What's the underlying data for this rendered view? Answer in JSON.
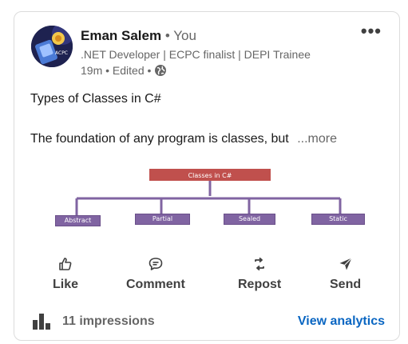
{
  "author": {
    "name": "Eman Salem",
    "relation": "• You",
    "headline": ".NET Developer | ECPC finalist | DEPI Trainee",
    "meta": "19m • Edited •",
    "avatar_text": "ACPC"
  },
  "post": {
    "title": "Types of Classes in C#",
    "body": "The foundation of any program is classes, but",
    "more_label": "...more"
  },
  "diagram": {
    "root": "Classes in C#",
    "children": [
      "Abstract",
      "Partial",
      "Sealed",
      "Static"
    ],
    "colors": {
      "root": "#c0504d",
      "child": "#8064a2",
      "line": "#8064a2"
    }
  },
  "actions": {
    "like": "Like",
    "comment": "Comment",
    "repost": "Repost",
    "send": "Send"
  },
  "footer": {
    "impressions": "11 impressions",
    "analytics": "View analytics"
  },
  "colors": {
    "link": "#0a66c2",
    "text_primary": "#191919",
    "text_secondary": "#666666"
  }
}
